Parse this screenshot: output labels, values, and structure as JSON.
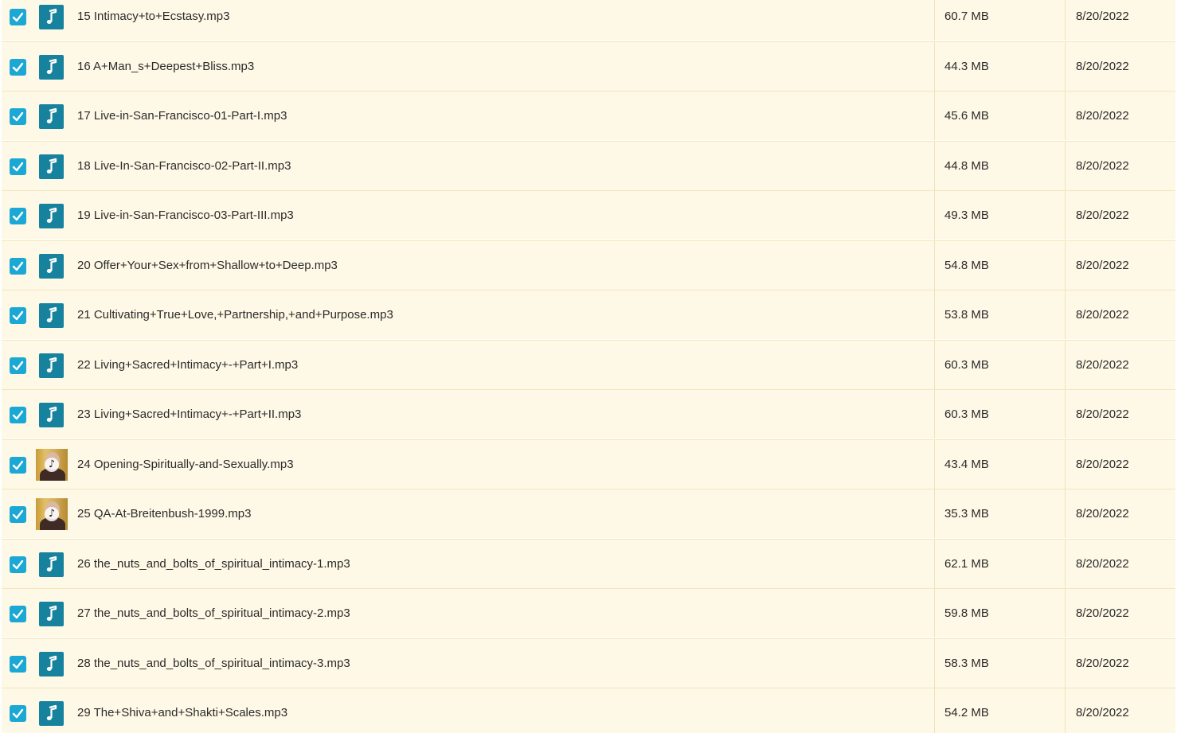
{
  "colors": {
    "row_background": "#fef8e6",
    "row_border": "#f3e6bd",
    "checkbox": "#1ba8d4",
    "audio_icon": "#17829e",
    "text": "#2b2b2b"
  },
  "files": [
    {
      "name": "15 Intimacy+to+Ecstasy.mp3",
      "size": "60.7 MB",
      "date": "8/20/2022",
      "checked": true,
      "thumb": "music-note-icon"
    },
    {
      "name": "16 A+Man_s+Deepest+Bliss.mp3",
      "size": "44.3 MB",
      "date": "8/20/2022",
      "checked": true,
      "thumb": "music-note-icon"
    },
    {
      "name": "17 Live-in-San-Francisco-01-Part-I.mp3",
      "size": "45.6 MB",
      "date": "8/20/2022",
      "checked": true,
      "thumb": "music-note-icon"
    },
    {
      "name": "18 Live-In-San-Francisco-02-Part-II.mp3",
      "size": "44.8 MB",
      "date": "8/20/2022",
      "checked": true,
      "thumb": "music-note-icon"
    },
    {
      "name": "19 Live-in-San-Francisco-03-Part-III.mp3",
      "size": "49.3 MB",
      "date": "8/20/2022",
      "checked": true,
      "thumb": "music-note-icon"
    },
    {
      "name": "20 Offer+Your+Sex+from+Shallow+to+Deep.mp3",
      "size": "54.8 MB",
      "date": "8/20/2022",
      "checked": true,
      "thumb": "music-note-icon"
    },
    {
      "name": "21 Cultivating+True+Love,+Partnership,+and+Purpose.mp3",
      "size": "53.8 MB",
      "date": "8/20/2022",
      "checked": true,
      "thumb": "music-note-icon"
    },
    {
      "name": "22 Living+Sacred+Intimacy+-+Part+I.mp3",
      "size": "60.3 MB",
      "date": "8/20/2022",
      "checked": true,
      "thumb": "music-note-icon"
    },
    {
      "name": "23 Living+Sacred+Intimacy+-+Part+II.mp3",
      "size": "60.3 MB",
      "date": "8/20/2022",
      "checked": true,
      "thumb": "music-note-icon"
    },
    {
      "name": "24 Opening-Spiritually-and-Sexually.mp3",
      "size": "43.4 MB",
      "date": "8/20/2022",
      "checked": true,
      "thumb": "album-art-thumbnail"
    },
    {
      "name": "25 QA-At-Breitenbush-1999.mp3",
      "size": "35.3 MB",
      "date": "8/20/2022",
      "checked": true,
      "thumb": "album-art-thumbnail"
    },
    {
      "name": "26 the_nuts_and_bolts_of_spiritual_intimacy-1.mp3",
      "size": "62.1 MB",
      "date": "8/20/2022",
      "checked": true,
      "thumb": "music-note-icon"
    },
    {
      "name": "27 the_nuts_and_bolts_of_spiritual_intimacy-2.mp3",
      "size": "59.8 MB",
      "date": "8/20/2022",
      "checked": true,
      "thumb": "music-note-icon"
    },
    {
      "name": "28 the_nuts_and_bolts_of_spiritual_intimacy-3.mp3",
      "size": "58.3 MB",
      "date": "8/20/2022",
      "checked": true,
      "thumb": "music-note-icon"
    },
    {
      "name": "29 The+Shiva+and+Shakti+Scales.mp3",
      "size": "54.2 MB",
      "date": "8/20/2022",
      "checked": true,
      "thumb": "music-note-icon"
    }
  ]
}
